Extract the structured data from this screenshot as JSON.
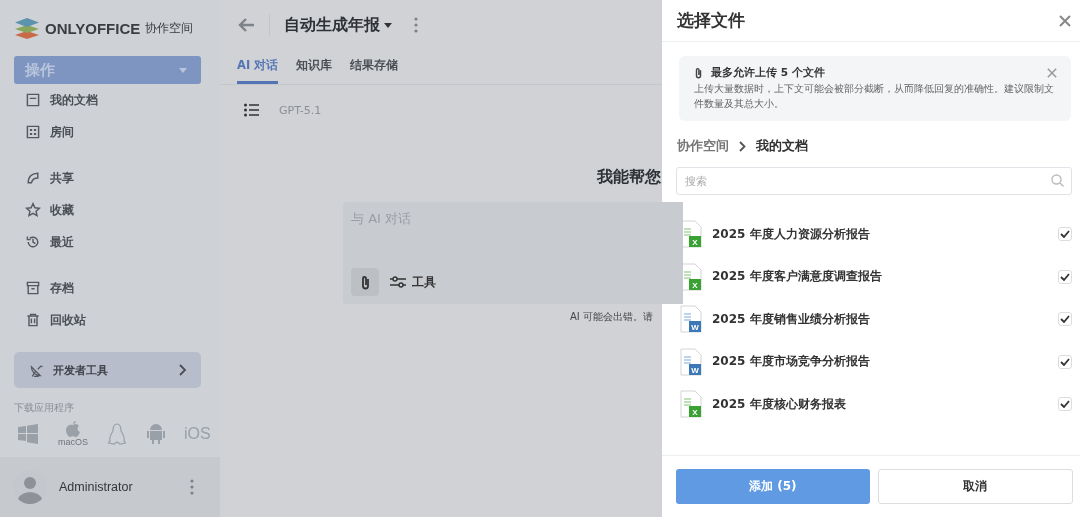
{
  "sidebar": {
    "logo": {
      "brand": "ONLYOFFICE",
      "product": "协作空间"
    },
    "actions_button": "操作",
    "groups": [
      [
        {
          "label": "我的文档"
        },
        {
          "label": "房间"
        }
      ],
      [
        {
          "label": "共享"
        },
        {
          "label": "收藏"
        },
        {
          "label": "最近"
        }
      ],
      [
        {
          "label": "存档"
        },
        {
          "label": "回收站"
        }
      ]
    ],
    "developer_tools": "开发者工具",
    "download_label": "下载应用程序",
    "apps": {
      "macos": "macOS",
      "ios": "iOS"
    },
    "user": "Administrator"
  },
  "main": {
    "title": "自动生成年报",
    "tabs": [
      {
        "label": "AI 对话",
        "selected": true
      },
      {
        "label": "知识库",
        "selected": false
      },
      {
        "label": "结果存储",
        "selected": false
      }
    ],
    "model": "GPT-5.1",
    "greeting": "我能帮您",
    "chat": {
      "placeholder": "与 AI 对话",
      "tools": "工具"
    },
    "disclaimer": "AI 可能会出错。请"
  },
  "dialog": {
    "title": "选择文件",
    "notice": {
      "title": "最多允许上传 5 个文件",
      "text": "上传大量数据时，上下文可能会被部分截断，从而降低回复的准确性。建议限制文件数量及其总大小。"
    },
    "breadcrumb": [
      {
        "label": "协作空间",
        "current": false
      },
      {
        "label": "我的文档",
        "current": true
      }
    ],
    "search": {
      "placeholder": "搜索"
    },
    "files": [
      {
        "name": "2025 年度人力资源分析报告",
        "kind": "sheet",
        "badge": "X",
        "checked": true
      },
      {
        "name": "2025 年度客户满意度调查报告",
        "kind": "sheet",
        "badge": "X",
        "checked": true
      },
      {
        "name": "2025 年度销售业绩分析报告",
        "kind": "doc",
        "badge": "W",
        "checked": true
      },
      {
        "name": "2025 年度市场竞争分析报告",
        "kind": "doc",
        "badge": "W",
        "checked": true
      },
      {
        "name": "2025 年度核心财务报表",
        "kind": "sheet",
        "badge": "X",
        "checked": true
      }
    ],
    "buttons": {
      "primary": "添加 (5)",
      "secondary": "取消"
    }
  }
}
